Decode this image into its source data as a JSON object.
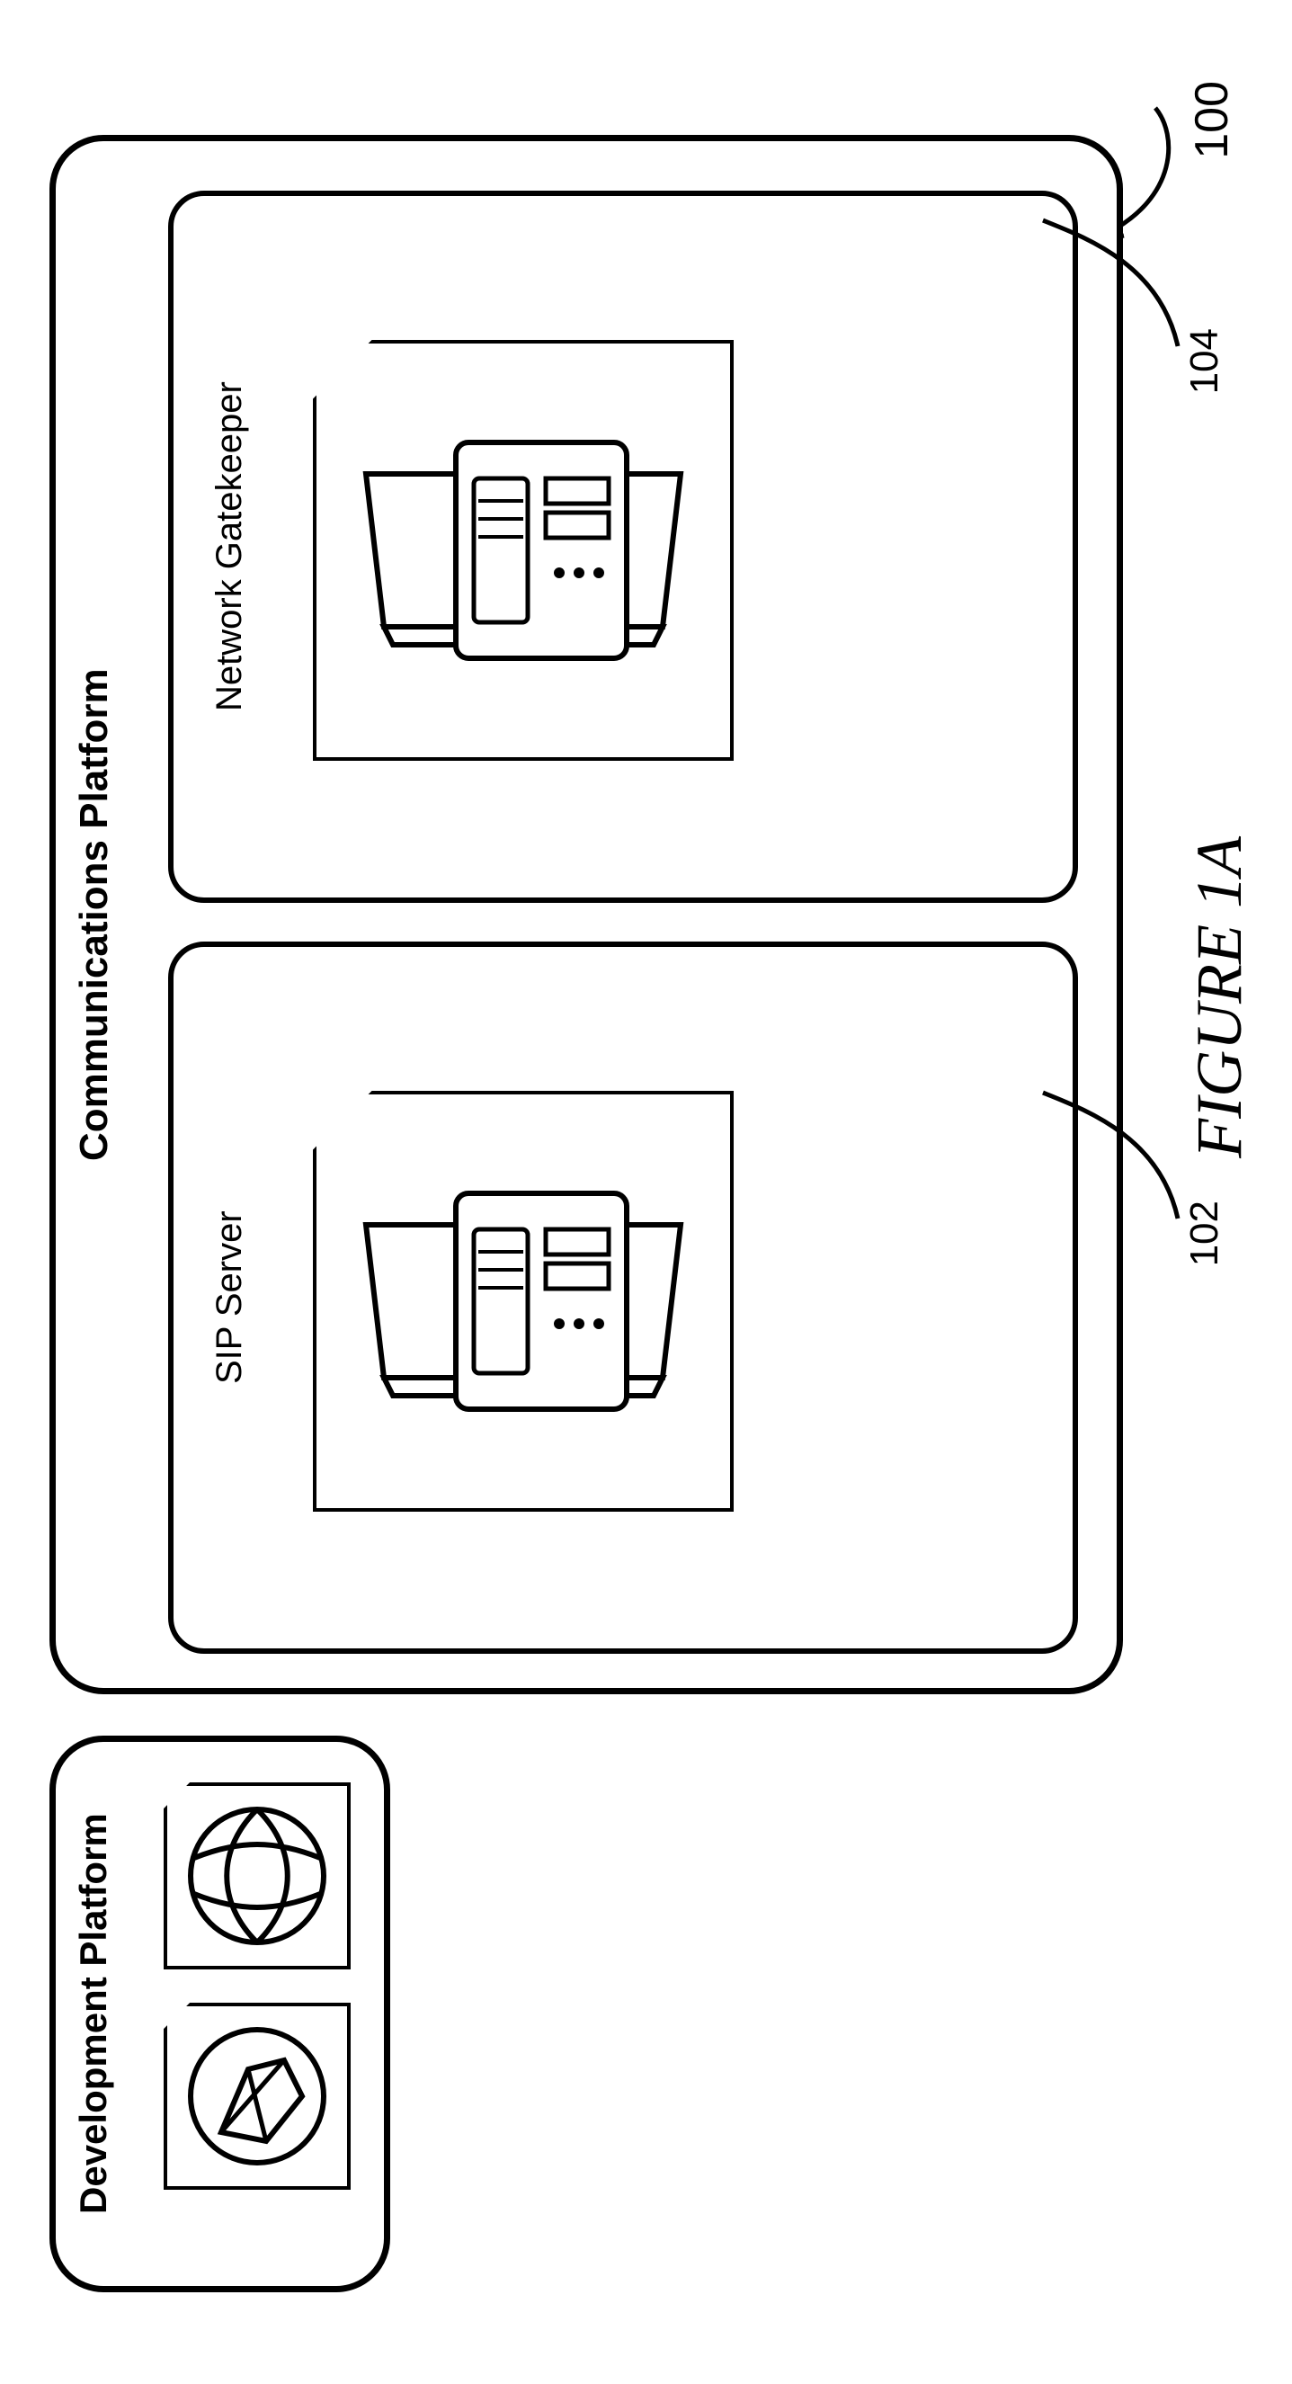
{
  "diagram_ref_number": "100",
  "dev_platform": {
    "title": "Development Platform"
  },
  "comm_platform": {
    "title": "Communications Platform",
    "sip": {
      "label": "SIP Server",
      "ref": "102"
    },
    "gatekeeper": {
      "label": "Network Gatekeeper",
      "ref": "104"
    }
  },
  "figure_label": "FIGURE 1A"
}
